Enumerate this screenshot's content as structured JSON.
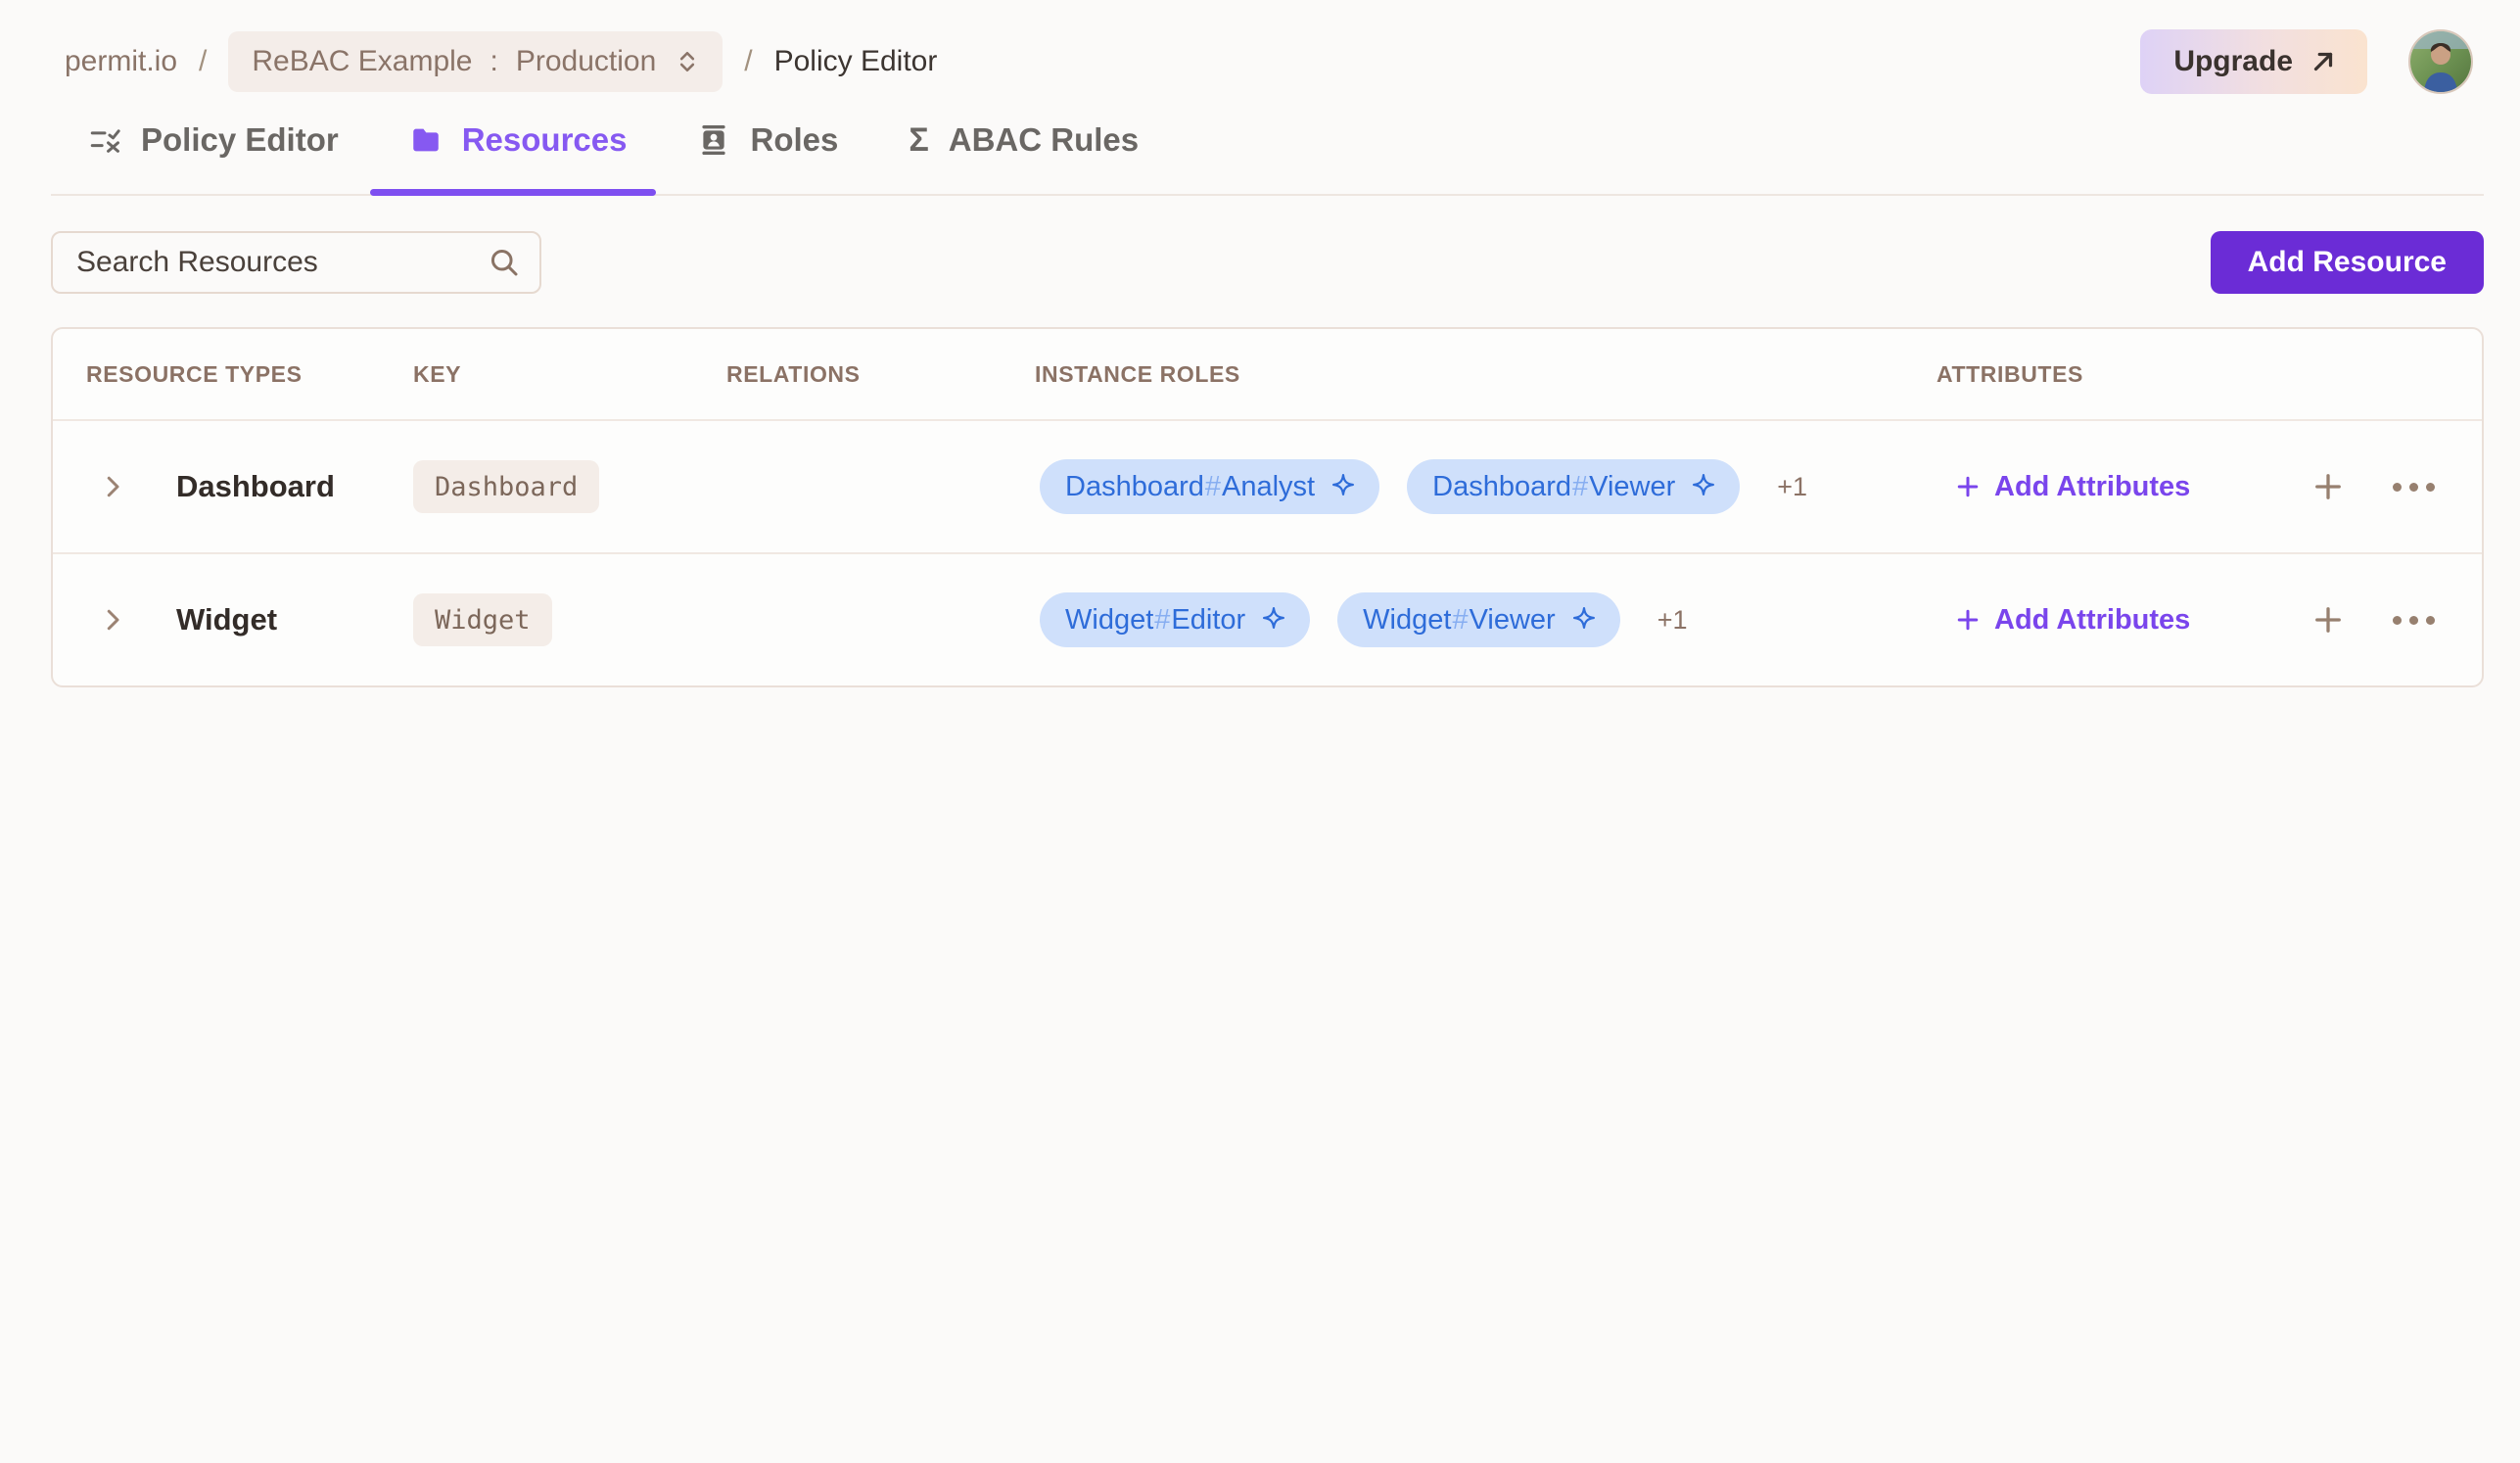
{
  "breadcrumb": {
    "org": "permit.io",
    "separator": "/",
    "project": "ReBAC Example",
    "project_env_separator": ":",
    "environment": "Production",
    "page": "Policy Editor"
  },
  "header": {
    "upgrade_label": "Upgrade",
    "avatar": "user-photo"
  },
  "tabs": [
    {
      "label": "Policy Editor",
      "icon": "policy-rules-icon",
      "active": false
    },
    {
      "label": "Resources",
      "icon": "folder-icon",
      "active": true
    },
    {
      "label": "Roles",
      "icon": "id-card-icon",
      "active": false
    },
    {
      "label": "ABAC Rules",
      "icon": "sigma-icon",
      "active": false
    }
  ],
  "icons": {
    "sigma_glyph": "Σ"
  },
  "toolbar": {
    "search_placeholder": "Search Resources",
    "add_resource_label": "Add Resource"
  },
  "table": {
    "columns": [
      "Resource Types",
      "Key",
      "Relations",
      "Instance Roles",
      "Attributes"
    ],
    "rows": [
      {
        "name": "Dashboard",
        "key": "Dashboard",
        "relations": "",
        "instance_roles": [
          {
            "resource": "Dashboard",
            "hash": "#",
            "role": "Analyst"
          },
          {
            "resource": "Dashboard",
            "hash": "#",
            "role": "Viewer"
          }
        ],
        "more_count": "+1",
        "add_attributes_label": "Add Attributes"
      },
      {
        "name": "Widget",
        "key": "Widget",
        "relations": "",
        "instance_roles": [
          {
            "resource": "Widget",
            "hash": "#",
            "role": "Editor"
          },
          {
            "resource": "Widget",
            "hash": "#",
            "role": "Viewer"
          }
        ],
        "more_count": "+1",
        "add_attributes_label": "Add Attributes"
      }
    ]
  },
  "colors": {
    "accent_purple": "#7e4ff0",
    "button_purple": "#6b2cd6",
    "chip_bg": "#cfe0fb",
    "chip_text": "#2e6cd9",
    "brown_text": "#8b7265",
    "page_bg": "#fbfaf9"
  }
}
